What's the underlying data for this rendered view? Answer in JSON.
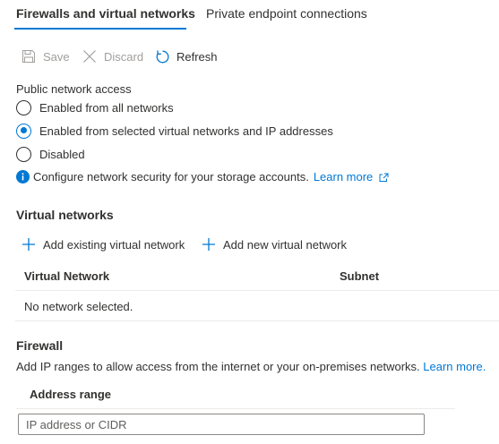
{
  "tabs": [
    {
      "label": "Firewalls and virtual networks",
      "active": true
    },
    {
      "label": "Private endpoint connections",
      "active": false
    }
  ],
  "toolbar": {
    "save_label": "Save",
    "discard_label": "Discard",
    "refresh_label": "Refresh"
  },
  "public_access": {
    "label": "Public network access",
    "options": [
      {
        "label": "Enabled from all networks",
        "selected": false
      },
      {
        "label": "Enabled from selected virtual networks and IP addresses",
        "selected": true
      },
      {
        "label": "Disabled",
        "selected": false
      }
    ],
    "info_text": "Configure network security for your storage accounts.",
    "info_link": "Learn more"
  },
  "virtual_networks": {
    "heading": "Virtual networks",
    "add_existing_label": "Add existing virtual network",
    "add_new_label": "Add new virtual network",
    "columns": [
      "Virtual Network",
      "Subnet"
    ],
    "empty_text": "No network selected."
  },
  "firewall": {
    "heading": "Firewall",
    "description": "Add IP ranges to allow access from the internet or your on-premises networks.",
    "learn_more": "Learn more.",
    "column": "Address range",
    "input_placeholder": "IP address or CIDR"
  },
  "colors": {
    "accent": "#0078d4",
    "text": "#323130",
    "disabled": "#a19f9d",
    "divider": "#edebe9"
  }
}
